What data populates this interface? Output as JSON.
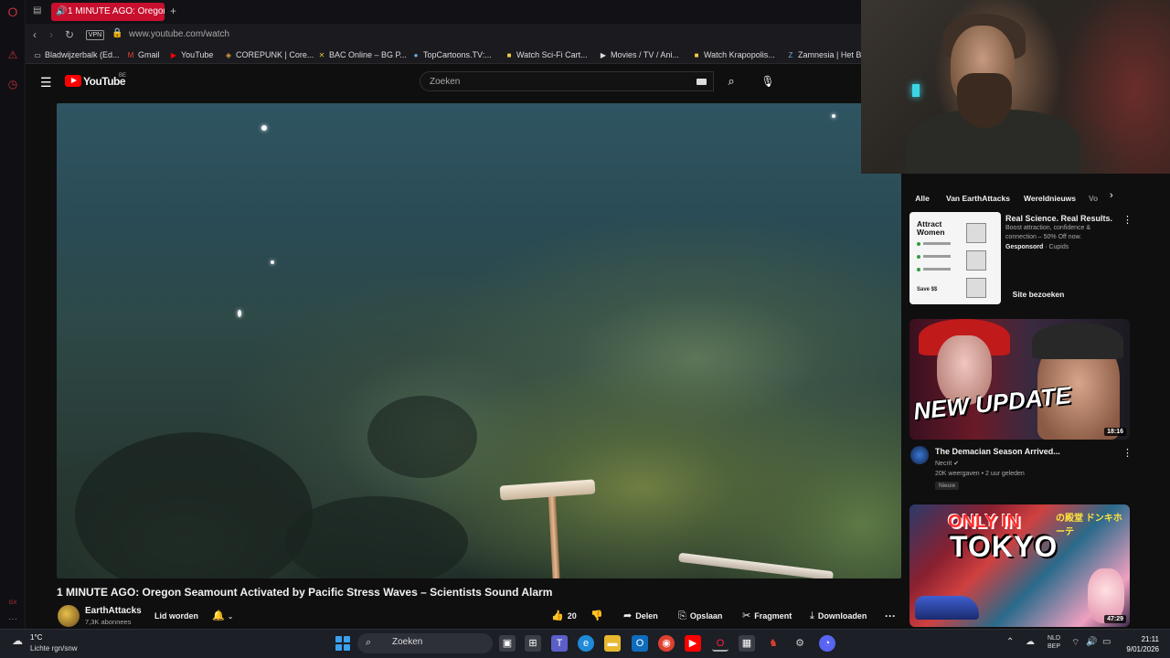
{
  "browser": {
    "tab_title": "1 MINUTE AGO: Oregon",
    "url": "www.youtube.com/watch",
    "vpn_label": "VPN",
    "bookmarks": [
      {
        "label": "Bladwijzerbalk (Ed...",
        "icon": "folder-icon"
      },
      {
        "label": "Gmail",
        "icon": "gmail-icon"
      },
      {
        "label": "YouTube",
        "icon": "youtube-icon"
      },
      {
        "label": "COREPUNK | Core...",
        "icon": "corepunk-icon"
      },
      {
        "label": "BAC Online – BG P...",
        "icon": "bac-icon"
      },
      {
        "label": "TopCartoons.TV:...",
        "icon": "topcartoons-icon"
      },
      {
        "label": "Watch Sci-Fi Cart...",
        "icon": "bookmark-icon"
      },
      {
        "label": "Movies / TV / Ani...",
        "icon": "play-icon"
      },
      {
        "label": "Watch Krapopolis...",
        "icon": "bookmark-icon"
      },
      {
        "label": "Zamnesia | Het Be",
        "icon": "z-icon"
      }
    ]
  },
  "youtube": {
    "logo_text": "YouTube",
    "region": "BE",
    "search_placeholder": "Zoeken",
    "video_title": "1 MINUTE AGO: Oregon Seamount Activated by Pacific Stress Waves – Scientists Sound Alarm",
    "channel_name": "EarthAttacks",
    "channel_subs": "7,3K abonnees",
    "join_label": "Lid worden",
    "actions": {
      "like_count": "20",
      "share": "Delen",
      "save": "Opslaan",
      "clip": "Fragment",
      "download": "Downloaden"
    },
    "chips": [
      "Alle",
      "Van EarthAttacks",
      "Wereldnieuws",
      "Vo"
    ],
    "ad": {
      "thumb_title": "Attract Women",
      "thumb_save": "Save $$",
      "title": "Real Science. Real Results.",
      "description": "Boost attraction, confidence & connection – 50% Off now.",
      "sponsored": "Gesponsord",
      "advertiser": "Cupids",
      "cta": "Site bezoeken"
    },
    "related": [
      {
        "title": "The Demacian Season Arrived...",
        "channel": "Necrit",
        "views": "20K weergaven",
        "age": "2 uur geleden",
        "badge": "Nieuw",
        "duration": "18:16",
        "thumb_text": "NEW UPDATE"
      },
      {
        "duration": "47:29",
        "thumb_text_1": "ONLY IN",
        "thumb_text_2": "TOKYO",
        "thumb_jp": "の殿堂 ドンキホーテ"
      }
    ]
  },
  "taskbar": {
    "temperature": "1°C",
    "weather": "Lichte rgn/snw",
    "search_placeholder": "Zoeken",
    "lang_line1": "NLD",
    "lang_line2": "BEP",
    "time": "21:11",
    "date": "9/01/2026",
    "start_color": "#3aa0f0"
  },
  "colors": {
    "opera_red": "#c8102e",
    "youtube_red": "#ff0000",
    "background": "#0f0f0f"
  }
}
